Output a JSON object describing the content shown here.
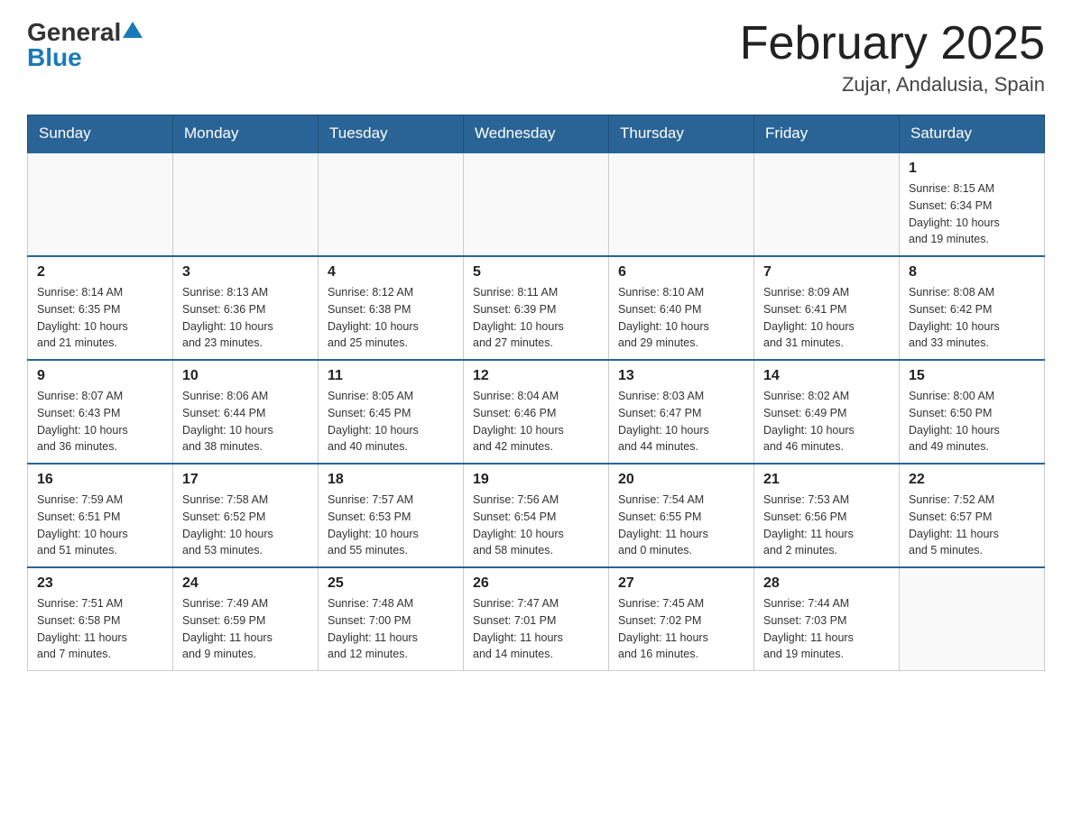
{
  "header": {
    "logo_general": "General",
    "logo_blue": "Blue",
    "month_title": "February 2025",
    "location": "Zujar, Andalusia, Spain"
  },
  "days_of_week": [
    "Sunday",
    "Monday",
    "Tuesday",
    "Wednesday",
    "Thursday",
    "Friday",
    "Saturday"
  ],
  "weeks": [
    {
      "days": [
        {
          "num": "",
          "info": ""
        },
        {
          "num": "",
          "info": ""
        },
        {
          "num": "",
          "info": ""
        },
        {
          "num": "",
          "info": ""
        },
        {
          "num": "",
          "info": ""
        },
        {
          "num": "",
          "info": ""
        },
        {
          "num": "1",
          "info": "Sunrise: 8:15 AM\nSunset: 6:34 PM\nDaylight: 10 hours\nand 19 minutes."
        }
      ]
    },
    {
      "days": [
        {
          "num": "2",
          "info": "Sunrise: 8:14 AM\nSunset: 6:35 PM\nDaylight: 10 hours\nand 21 minutes."
        },
        {
          "num": "3",
          "info": "Sunrise: 8:13 AM\nSunset: 6:36 PM\nDaylight: 10 hours\nand 23 minutes."
        },
        {
          "num": "4",
          "info": "Sunrise: 8:12 AM\nSunset: 6:38 PM\nDaylight: 10 hours\nand 25 minutes."
        },
        {
          "num": "5",
          "info": "Sunrise: 8:11 AM\nSunset: 6:39 PM\nDaylight: 10 hours\nand 27 minutes."
        },
        {
          "num": "6",
          "info": "Sunrise: 8:10 AM\nSunset: 6:40 PM\nDaylight: 10 hours\nand 29 minutes."
        },
        {
          "num": "7",
          "info": "Sunrise: 8:09 AM\nSunset: 6:41 PM\nDaylight: 10 hours\nand 31 minutes."
        },
        {
          "num": "8",
          "info": "Sunrise: 8:08 AM\nSunset: 6:42 PM\nDaylight: 10 hours\nand 33 minutes."
        }
      ]
    },
    {
      "days": [
        {
          "num": "9",
          "info": "Sunrise: 8:07 AM\nSunset: 6:43 PM\nDaylight: 10 hours\nand 36 minutes."
        },
        {
          "num": "10",
          "info": "Sunrise: 8:06 AM\nSunset: 6:44 PM\nDaylight: 10 hours\nand 38 minutes."
        },
        {
          "num": "11",
          "info": "Sunrise: 8:05 AM\nSunset: 6:45 PM\nDaylight: 10 hours\nand 40 minutes."
        },
        {
          "num": "12",
          "info": "Sunrise: 8:04 AM\nSunset: 6:46 PM\nDaylight: 10 hours\nand 42 minutes."
        },
        {
          "num": "13",
          "info": "Sunrise: 8:03 AM\nSunset: 6:47 PM\nDaylight: 10 hours\nand 44 minutes."
        },
        {
          "num": "14",
          "info": "Sunrise: 8:02 AM\nSunset: 6:49 PM\nDaylight: 10 hours\nand 46 minutes."
        },
        {
          "num": "15",
          "info": "Sunrise: 8:00 AM\nSunset: 6:50 PM\nDaylight: 10 hours\nand 49 minutes."
        }
      ]
    },
    {
      "days": [
        {
          "num": "16",
          "info": "Sunrise: 7:59 AM\nSunset: 6:51 PM\nDaylight: 10 hours\nand 51 minutes."
        },
        {
          "num": "17",
          "info": "Sunrise: 7:58 AM\nSunset: 6:52 PM\nDaylight: 10 hours\nand 53 minutes."
        },
        {
          "num": "18",
          "info": "Sunrise: 7:57 AM\nSunset: 6:53 PM\nDaylight: 10 hours\nand 55 minutes."
        },
        {
          "num": "19",
          "info": "Sunrise: 7:56 AM\nSunset: 6:54 PM\nDaylight: 10 hours\nand 58 minutes."
        },
        {
          "num": "20",
          "info": "Sunrise: 7:54 AM\nSunset: 6:55 PM\nDaylight: 11 hours\nand 0 minutes."
        },
        {
          "num": "21",
          "info": "Sunrise: 7:53 AM\nSunset: 6:56 PM\nDaylight: 11 hours\nand 2 minutes."
        },
        {
          "num": "22",
          "info": "Sunrise: 7:52 AM\nSunset: 6:57 PM\nDaylight: 11 hours\nand 5 minutes."
        }
      ]
    },
    {
      "days": [
        {
          "num": "23",
          "info": "Sunrise: 7:51 AM\nSunset: 6:58 PM\nDaylight: 11 hours\nand 7 minutes."
        },
        {
          "num": "24",
          "info": "Sunrise: 7:49 AM\nSunset: 6:59 PM\nDaylight: 11 hours\nand 9 minutes."
        },
        {
          "num": "25",
          "info": "Sunrise: 7:48 AM\nSunset: 7:00 PM\nDaylight: 11 hours\nand 12 minutes."
        },
        {
          "num": "26",
          "info": "Sunrise: 7:47 AM\nSunset: 7:01 PM\nDaylight: 11 hours\nand 14 minutes."
        },
        {
          "num": "27",
          "info": "Sunrise: 7:45 AM\nSunset: 7:02 PM\nDaylight: 11 hours\nand 16 minutes."
        },
        {
          "num": "28",
          "info": "Sunrise: 7:44 AM\nSunset: 7:03 PM\nDaylight: 11 hours\nand 19 minutes."
        },
        {
          "num": "",
          "info": ""
        }
      ]
    }
  ]
}
